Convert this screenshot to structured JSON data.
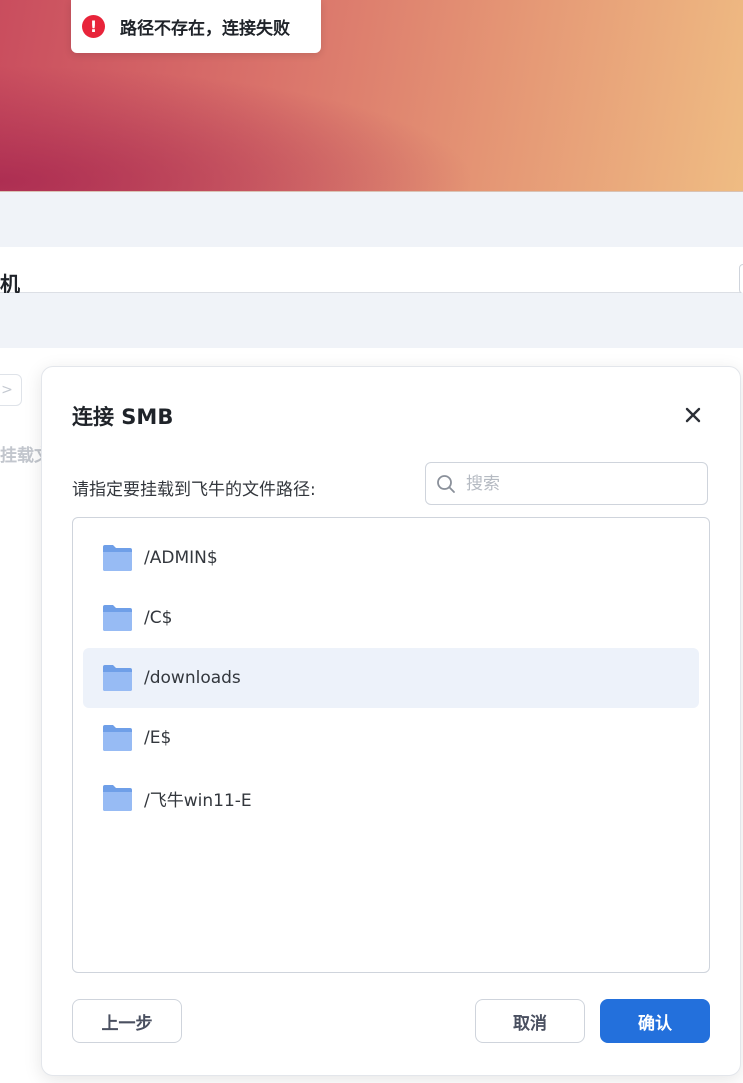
{
  "toast": {
    "message": "路径不存在，连接失败",
    "icon": "error-icon",
    "icon_glyph": "!"
  },
  "background": {
    "section_title": "机",
    "nav_arrow": ">",
    "partial_text": "挂载文"
  },
  "dialog": {
    "title": "连接 SMB",
    "prompt": "请指定要挂载到飞牛的文件路径:",
    "search": {
      "placeholder": "搜索",
      "value": ""
    },
    "folders": [
      {
        "label": "/ADMIN$",
        "selected": false
      },
      {
        "label": "/C$",
        "selected": false
      },
      {
        "label": "/downloads",
        "selected": true
      },
      {
        "label": "/E$",
        "selected": false
      },
      {
        "label": "/飞牛win11-E",
        "selected": false
      }
    ],
    "buttons": {
      "back": "上一步",
      "cancel": "取消",
      "confirm": "确认"
    }
  },
  "colors": {
    "primary": "#2370dc",
    "error": "#e8243a",
    "folder": "#8fb4f2",
    "selected_row": "#edf2fa"
  }
}
